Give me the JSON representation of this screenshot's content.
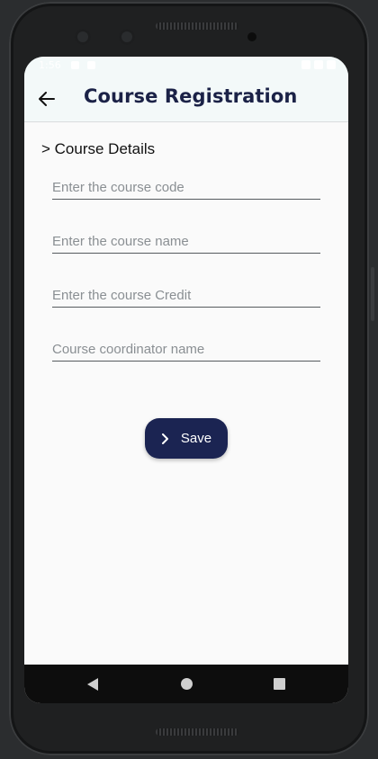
{
  "statusbar": {
    "time": "1:56"
  },
  "appbar": {
    "title": "Course Registration",
    "back_icon": "arrow-left-icon"
  },
  "form": {
    "section_title": "> Course Details",
    "fields": [
      {
        "placeholder": "Enter the course code",
        "value": ""
      },
      {
        "placeholder": "Enter the course name",
        "value": ""
      },
      {
        "placeholder": "Enter the course Credit",
        "value": ""
      },
      {
        "placeholder": "Course coordinator name",
        "value": ""
      }
    ],
    "save_label": "Save",
    "save_icon": "chevron-right-icon"
  },
  "colors": {
    "primary": "#1b2452",
    "appbar_bg": "#f3f9f9",
    "screen_bg": "#fafafa"
  }
}
